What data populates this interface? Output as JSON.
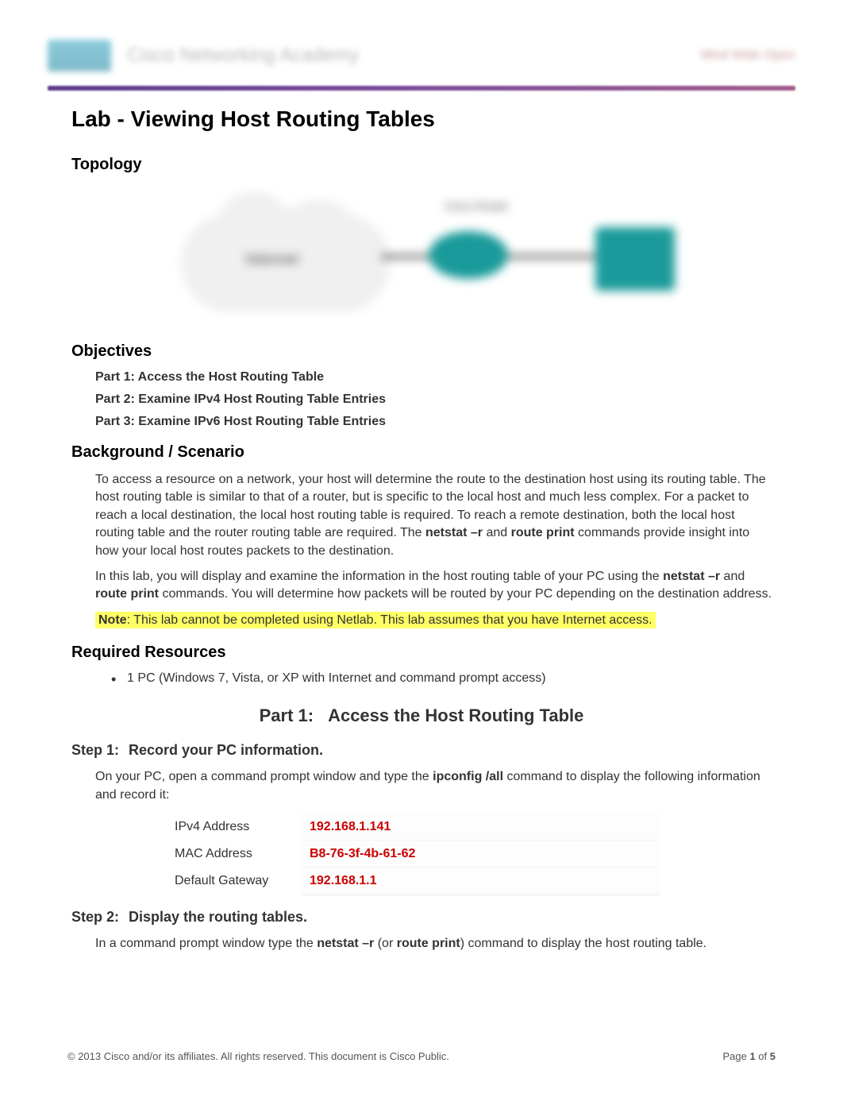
{
  "banner": {
    "brand_text": "Cisco Networking Academy",
    "right_text": "Mind Wide Open"
  },
  "title": "Lab - Viewing Host Routing Tables",
  "headings": {
    "topology": "Topology",
    "objectives": "Objectives",
    "background": "Background / Scenario",
    "resources": "Required Resources"
  },
  "topology_labels": {
    "internet": "Internet",
    "router": "Cisco Router"
  },
  "objectives": [
    "Part 1: Access the Host Routing Table",
    "Part 2: Examine IPv4 Host Routing Table Entries",
    "Part 3: Examine IPv6 Host Routing Table Entries"
  ],
  "background": {
    "p1_a": "To access a resource on a network, your host will determine the route to the destination host using its routing table. The host routing table is similar to that of a router, but is specific to the local host and much less complex. For a packet to reach a local destination, the local host routing table is required. To reach a remote destination, both the local host routing table and the router routing table are required. The ",
    "p1_b": "netstat –r",
    "p1_c": " and ",
    "p1_d": "route print",
    "p1_e": " commands provide insight into how your local host routes packets to the destination.",
    "p2_a": "In this lab, you will display and examine the information in the host routing table of your PC using the ",
    "p2_b": "netstat –r",
    "p2_c": " and ",
    "p2_d": "route print",
    "p2_e": " commands. You will determine how packets will be routed by your PC depending on the destination address.",
    "note_label": "Note",
    "note_text": ": This lab cannot be completed using Netlab. This lab assumes that you have Internet access."
  },
  "resources": {
    "item1": "1 PC (Windows 7, Vista, or XP with Internet and command prompt access)"
  },
  "part1": {
    "num": "Part 1:",
    "title": "Access the Host Routing Table"
  },
  "step1": {
    "num": "Step 1:",
    "title": "Record your PC information.",
    "intro_a": "On your PC, open a command prompt window and type the ",
    "intro_b": "ipconfig /all",
    "intro_c": " command to display the following information and record it:",
    "rows": [
      {
        "label": "IPv4 Address",
        "value": "192.168.1.141"
      },
      {
        "label": "MAC Address",
        "value": "B8-76-3f-4b-61-62"
      },
      {
        "label": "Default Gateway",
        "value": "192.168.1.1"
      }
    ]
  },
  "step2": {
    "num": "Step 2:",
    "title": "Display the routing tables.",
    "intro_a": "In a command prompt window type the ",
    "intro_b": "netstat –r",
    "intro_c": " (or ",
    "intro_d": "route print",
    "intro_e": ") command to display the host routing table."
  },
  "footer": {
    "copyright": "© 2013 Cisco and/or its affiliates. All rights reserved. This document is Cisco Public.",
    "page_label_a": "Page ",
    "page_current": "1",
    "page_label_b": " of ",
    "page_total": "5"
  }
}
